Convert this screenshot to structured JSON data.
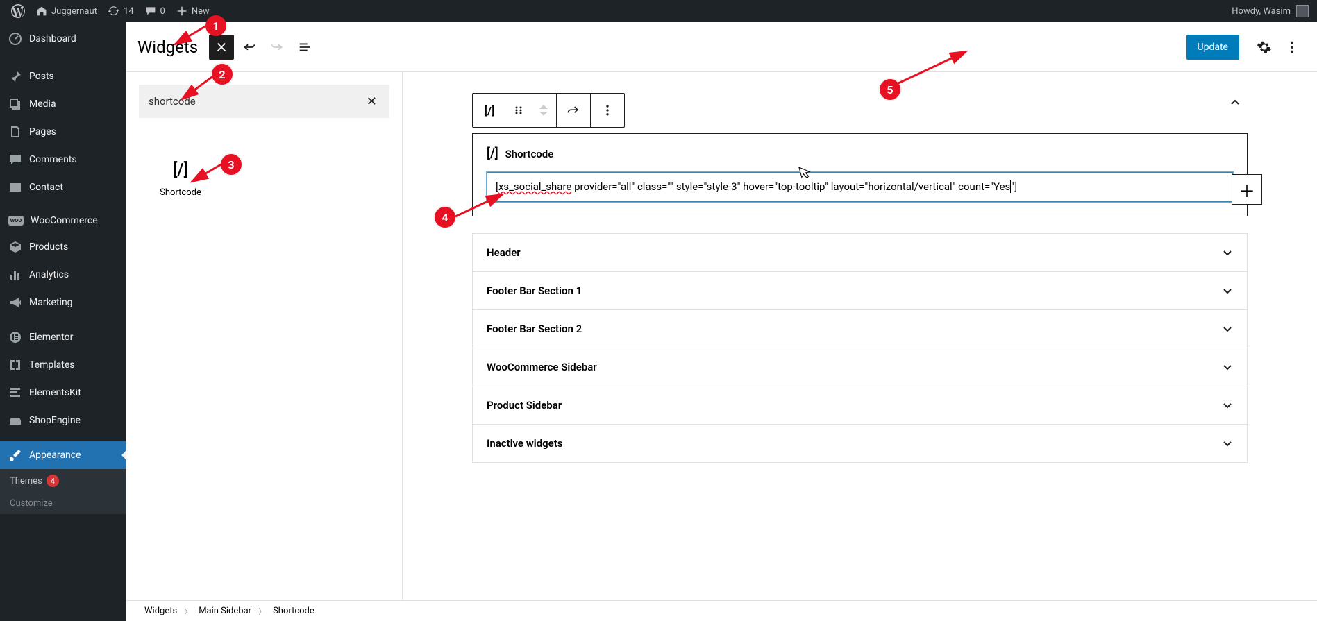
{
  "adminbar": {
    "site_name": "Juggernaut",
    "updates_count": "14",
    "comments_count": "0",
    "new_label": "New",
    "howdy_prefix": "Howdy, ",
    "user_name": "Wasim"
  },
  "sidebar": {
    "items": [
      {
        "icon": "dashboard",
        "label": "Dashboard"
      },
      {
        "icon": "pin",
        "label": "Posts"
      },
      {
        "icon": "media",
        "label": "Media"
      },
      {
        "icon": "page",
        "label": "Pages"
      },
      {
        "icon": "comment",
        "label": "Comments"
      },
      {
        "icon": "mail",
        "label": "Contact"
      },
      {
        "icon": "woo",
        "label": "WooCommerce"
      },
      {
        "icon": "box",
        "label": "Products"
      },
      {
        "icon": "chart",
        "label": "Analytics"
      },
      {
        "icon": "horn",
        "label": "Marketing"
      },
      {
        "icon": "elementor",
        "label": "Elementor"
      },
      {
        "icon": "templates",
        "label": "Templates"
      },
      {
        "icon": "ekit",
        "label": "ElementsKit"
      },
      {
        "icon": "shopengine",
        "label": "ShopEngine"
      },
      {
        "icon": "brush",
        "label": "Appearance",
        "current": true
      }
    ],
    "submenu": {
      "themes_label": "Themes",
      "themes_count": "4",
      "customize_label": "Customize"
    }
  },
  "editor": {
    "title": "Widgets",
    "update_label": "Update",
    "search_value": "shortcode",
    "block_result_label": "Shortcode"
  },
  "canvas": {
    "shortcode_block_title": "Shortcode",
    "shortcode_value": "[xs_social_share provider=\"all\" class=\"\" style=\"style-3\" hover=\"top-tooltip\" layout=\"horizontal/vertical\" count=\"Yes\"]",
    "areas": [
      "Header",
      "Footer Bar Section 1",
      "Footer Bar Section 2",
      "WooCommerce Sidebar",
      "Product Sidebar",
      "Inactive widgets"
    ]
  },
  "breadcrumb": {
    "level1": "Widgets",
    "level2": "Main Sidebar",
    "level3": "Shortcode"
  },
  "annotations": [
    "1",
    "2",
    "3",
    "4",
    "5"
  ]
}
